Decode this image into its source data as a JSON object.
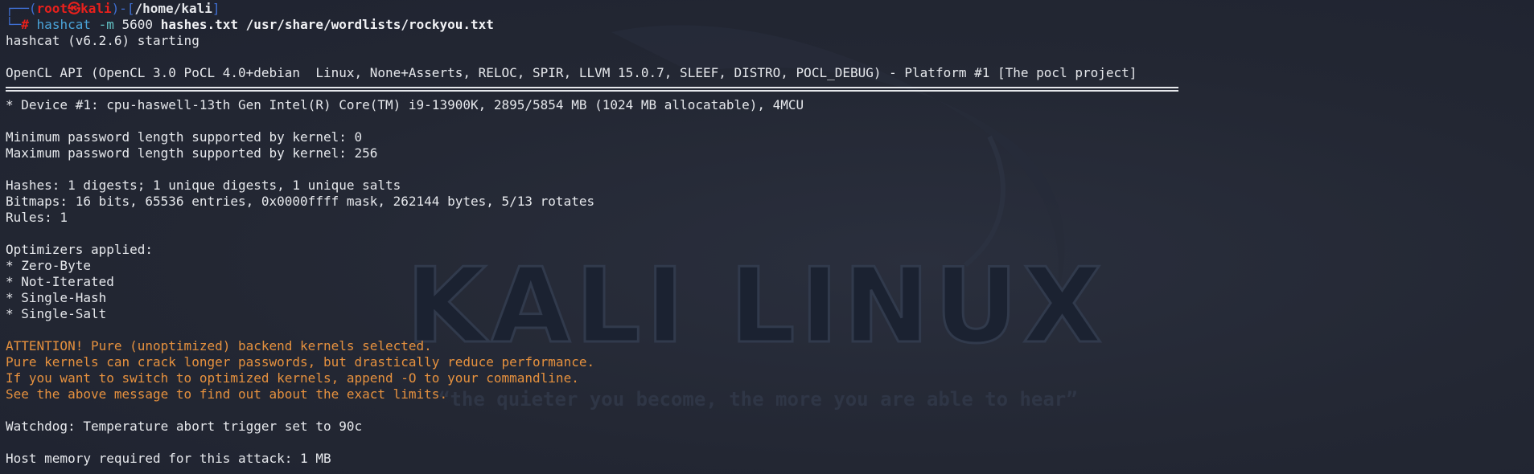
{
  "watermark": {
    "title": "KALI LINUX",
    "tagline": "“the quieter you become, the more you are able to hear”"
  },
  "prompt": {
    "line1_frame_open": "┌──(",
    "user_host": "root㉿kali",
    "line1_frame_mid": ")-[",
    "cwd": "/home/kali",
    "line1_frame_close": "]",
    "line2_frame": "└─",
    "symbol": "#",
    "command": "hashcat",
    "flag": "-m",
    "mode": "5600",
    "arg_hashes": "hashes.txt",
    "arg_wordlist": "/usr/share/wordlists/rockyou.txt"
  },
  "output": {
    "starting": "hashcat (v6.2.6) starting",
    "opencl_api": "OpenCL API (OpenCL 3.0 PoCL 4.0+debian  Linux, None+Asserts, RELOC, SPIR, LLVM 15.0.7, SLEEF, DISTRO, POCL_DEBUG) - Platform #1 [The pocl project]",
    "device": "* Device #1: cpu-haswell-13th Gen Intel(R) Core(TM) i9-13900K, 2895/5854 MB (1024 MB allocatable), 4MCU",
    "min_pw": "Minimum password length supported by kernel: 0",
    "max_pw": "Maximum password length supported by kernel: 256",
    "hashes": "Hashes: 1 digests; 1 unique digests, 1 unique salts",
    "bitmaps": "Bitmaps: 16 bits, 65536 entries, 0x0000ffff mask, 262144 bytes, 5/13 rotates",
    "rules": "Rules: 1",
    "optimizers_header": "Optimizers applied:",
    "optimizers": [
      "* Zero-Byte",
      "* Not-Iterated",
      "* Single-Hash",
      "* Single-Salt"
    ],
    "attention": [
      "ATTENTION! Pure (unoptimized) backend kernels selected.",
      "Pure kernels can crack longer passwords, but drastically reduce performance.",
      "If you want to switch to optimized kernels, append -O to your commandline.",
      "See the above message to find out about the exact limits."
    ],
    "watchdog": "Watchdog: Temperature abort trigger set to 90c",
    "host_memory": "Host memory required for this attack: 1 MB"
  },
  "colors": {
    "background": "#232733",
    "text": "#e6e8ec",
    "prompt_frame": "#3f6fd2",
    "prompt_user": "#e8201c",
    "command": "#4aa3d8",
    "warning": "#e6913e"
  }
}
